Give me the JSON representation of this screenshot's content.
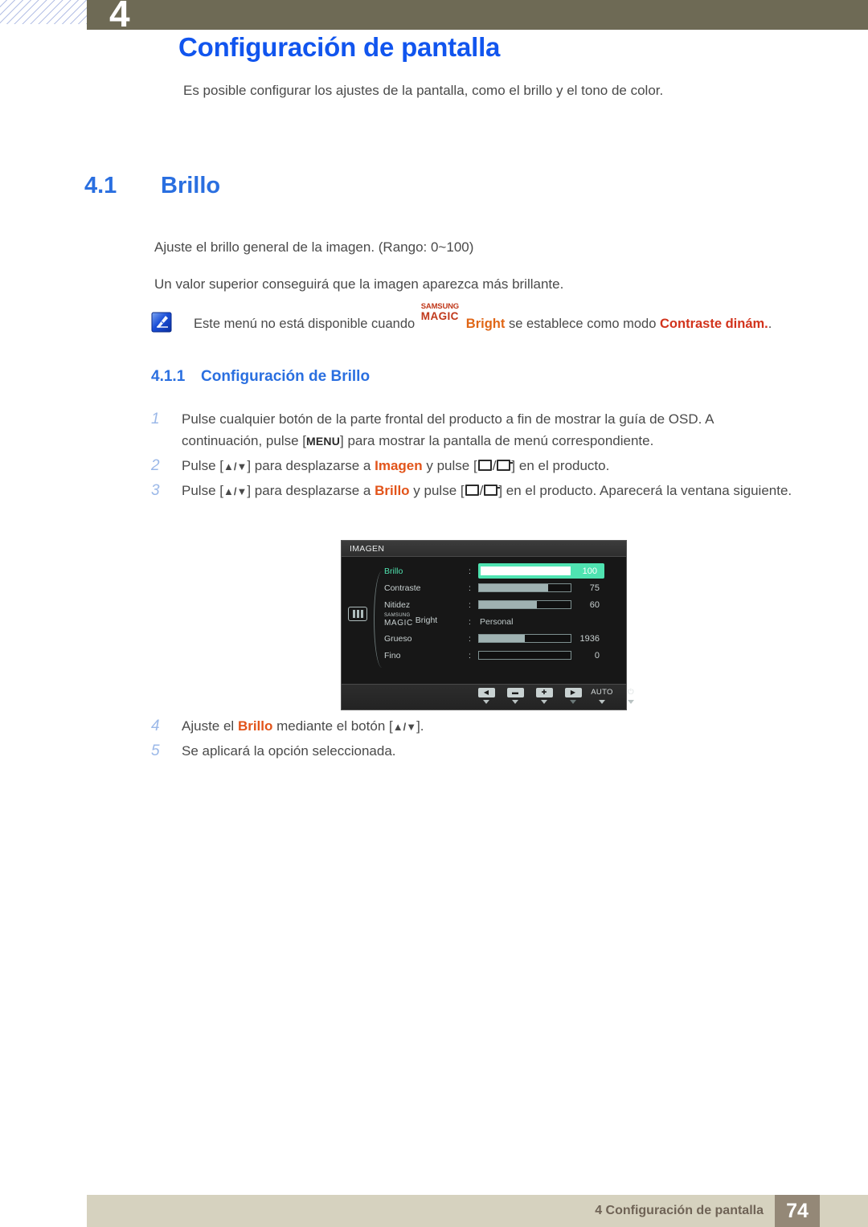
{
  "header": {
    "chapter_number": "4",
    "page_title": "Configuración de pantalla",
    "intro": "Es posible configurar los ajustes de la pantalla, como el brillo y el tono de color."
  },
  "section": {
    "number": "4.1",
    "title": "Brillo",
    "paragraph_1": "Ajuste el brillo general de la imagen. (Rango: 0~100)",
    "paragraph_2": "Un valor superior conseguirá que la imagen aparezca más brillante."
  },
  "note": {
    "icon": "note-pen-icon",
    "text_before": "Este menú no está disponible cuando",
    "logo_top": "SAMSUNG",
    "logo_bottom": "MAGIC",
    "logo_suffix": "Bright",
    "text_middle": "se establece como modo",
    "text_highlight": "Contraste dinám.",
    "text_after": "."
  },
  "subsection": {
    "number": "4.1.1",
    "title": "Configuración de Brillo"
  },
  "steps": [
    {
      "num": "1",
      "parts": [
        {
          "t": "Pulse cualquier botón de la parte frontal del producto a fin de mostrar la guía de OSD. A continuación, pulse [",
          "k": "text"
        },
        {
          "t": "MENU",
          "k": "kbd"
        },
        {
          "t": "] para mostrar la pantalla de menú correspondiente.",
          "k": "text"
        }
      ]
    },
    {
      "num": "2",
      "parts": [
        {
          "t": "Pulse [",
          "k": "text"
        },
        {
          "t": "▲/▼",
          "k": "arrows"
        },
        {
          "t": "] para desplazarse a ",
          "k": "text"
        },
        {
          "t": "Imagen",
          "k": "orange"
        },
        {
          "t": " y pulse [",
          "k": "text"
        },
        {
          "t": "box",
          "k": "glyph-box"
        },
        {
          "t": "/",
          "k": "text"
        },
        {
          "t": "ret",
          "k": "glyph-ret"
        },
        {
          "t": "] en el producto.",
          "k": "text"
        }
      ]
    },
    {
      "num": "3",
      "parts": [
        {
          "t": "Pulse [",
          "k": "text"
        },
        {
          "t": "▲/▼",
          "k": "arrows"
        },
        {
          "t": "] para desplazarse a ",
          "k": "text"
        },
        {
          "t": "Brillo",
          "k": "orange"
        },
        {
          "t": " y pulse [",
          "k": "text"
        },
        {
          "t": "box",
          "k": "glyph-box"
        },
        {
          "t": "/",
          "k": "text"
        },
        {
          "t": "ret",
          "k": "glyph-ret"
        },
        {
          "t": "] en el producto. Aparecerá la ventana siguiente.",
          "k": "text"
        }
      ]
    },
    {
      "num": "4",
      "parts": [
        {
          "t": "Ajuste el ",
          "k": "text"
        },
        {
          "t": "Brillo",
          "k": "orange"
        },
        {
          "t": " mediante el botón [",
          "k": "text"
        },
        {
          "t": "▲/▼",
          "k": "arrows"
        },
        {
          "t": "].",
          "k": "text"
        }
      ]
    },
    {
      "num": "5",
      "parts": [
        {
          "t": "Se aplicará la opción seleccionada.",
          "k": "text"
        }
      ]
    }
  ],
  "osd": {
    "title": "IMAGEN",
    "side_icon": "picture-bars-icon",
    "rows": [
      {
        "label": "Brillo",
        "type": "slider",
        "value": "100",
        "fill": 100,
        "selected": true
      },
      {
        "label": "Contraste",
        "type": "slider",
        "value": "75",
        "fill": 75,
        "selected": false
      },
      {
        "label": "Nitidez",
        "type": "slider",
        "value": "60",
        "fill": 63,
        "selected": false
      },
      {
        "label": "MAGIC Bright",
        "logo_top": "SAMSUNG",
        "logo_bottom": "MAGIC",
        "logo_suffix": "Bright",
        "type": "text",
        "value": "Personal",
        "selected": false
      },
      {
        "label": "Grueso",
        "type": "slider",
        "value": "1936",
        "fill": 50,
        "selected": false
      },
      {
        "label": "Fino",
        "type": "slider",
        "value": "0",
        "fill": 0,
        "selected": false
      }
    ],
    "buttons": [
      {
        "name": "osd-button-left",
        "glyph": "◀",
        "style": "cap"
      },
      {
        "name": "osd-button-minus",
        "glyph": "▬",
        "style": "cap"
      },
      {
        "name": "osd-button-plus",
        "glyph": "✚",
        "style": "cap"
      },
      {
        "name": "osd-button-right",
        "glyph": "▶",
        "style": "cap"
      },
      {
        "name": "osd-button-auto",
        "glyph": "AUTO",
        "style": "plain"
      },
      {
        "name": "osd-button-power",
        "glyph": "⏻",
        "style": "plain"
      }
    ]
  },
  "footer": {
    "text": "4 Configuración de pantalla",
    "page_number": "74"
  },
  "colors": {
    "olive": "#6e6a55",
    "title_blue": "#1155ee",
    "section_blue": "#2a6fe0",
    "orange": "#e2541a",
    "red": "#d2331c",
    "osd_green": "#4fe3b1",
    "footer_beige": "#d6d2bf",
    "footer_taupe": "#948877"
  }
}
